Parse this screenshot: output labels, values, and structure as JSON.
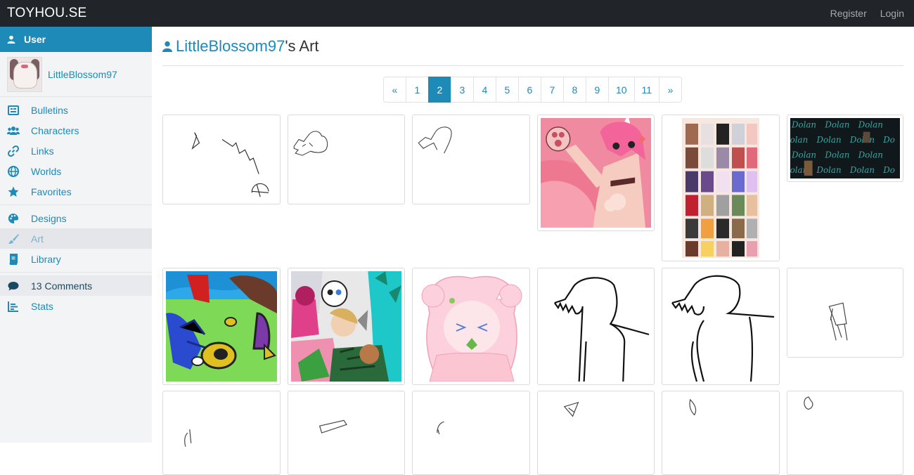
{
  "brand": "TOYHOU.SE",
  "topnav": {
    "register": "Register",
    "login": "Login"
  },
  "sidebar": {
    "header": "User",
    "username": "LittleBlossom97",
    "group1": [
      {
        "label": "Bulletins",
        "icon": "bulletin-icon"
      },
      {
        "label": "Characters",
        "icon": "characters-icon"
      },
      {
        "label": "Links",
        "icon": "link-icon"
      },
      {
        "label": "Worlds",
        "icon": "globe-icon"
      },
      {
        "label": "Favorites",
        "icon": "star-icon"
      }
    ],
    "group2": [
      {
        "label": "Designs",
        "icon": "palette-icon"
      },
      {
        "label": "Art",
        "icon": "brush-icon"
      },
      {
        "label": "Library",
        "icon": "book-icon"
      }
    ],
    "group3": [
      {
        "label": "13 Comments",
        "icon": "comment-icon"
      },
      {
        "label": "Stats",
        "icon": "chart-icon"
      }
    ]
  },
  "page": {
    "title_name": "LittleBlossom97",
    "title_suffix": "'s Art"
  },
  "pagination": [
    "«",
    "1",
    "2",
    "3",
    "4",
    "5",
    "6",
    "7",
    "8",
    "9",
    "10",
    "11",
    "»"
  ],
  "pagination_current": "2",
  "colors": {
    "accent": "#1d8ab8",
    "topbar": "#212529",
    "sidebar": "#f3f4f6"
  }
}
